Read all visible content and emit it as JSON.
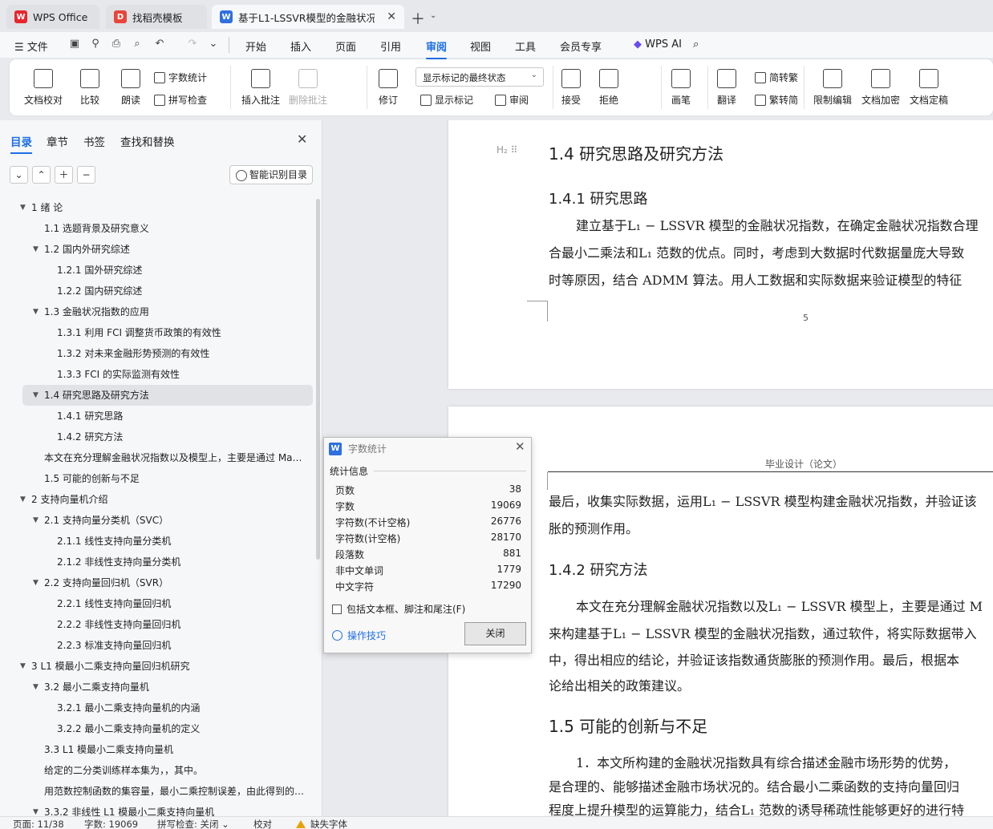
{
  "tabs": [
    {
      "label": "WPS Office",
      "icon": "wps-logo-icon"
    },
    {
      "label": "找稻壳模板",
      "icon": "docer-icon"
    },
    {
      "label": "基于L1-LSSVR模型的金融状况",
      "icon": "word-doc-icon"
    }
  ],
  "menu": {
    "file": "文件",
    "items": [
      "开始",
      "插入",
      "页面",
      "引用",
      "审阅",
      "视图",
      "工具",
      "会员专享"
    ],
    "active": "审阅",
    "ai": "WPS AI"
  },
  "ribbon": {
    "doc_proof": "文档校对",
    "compare": "比较",
    "read_aloud": "朗读",
    "word_count": "字数统计",
    "spell_check": "拼写检查",
    "insert_comment": "插入批注",
    "delete_comment": "删除批注",
    "track_changes": "修订",
    "markup_state": "显示标记的最终状态",
    "show_markup": "显示标记",
    "review_pane": "审阅",
    "accept": "接受",
    "reject": "拒绝",
    "pen": "画笔",
    "translate": "翻译",
    "to_traditional": "简转繁",
    "to_simplified": "繁转简",
    "restrict_edit": "限制编辑",
    "encrypt": "文档加密",
    "finalize": "文档定稿"
  },
  "nav": {
    "tabs": [
      "目录",
      "章节",
      "书签",
      "查找和替换"
    ],
    "smart_toc": "智能识别目录",
    "toc": [
      {
        "label": "1 绪 论",
        "level": 0,
        "arrow": true
      },
      {
        "label": "1.1 选题背景及研究意义",
        "level": 1,
        "arrow": false
      },
      {
        "label": "1.2 国内外研究综述",
        "level": 1,
        "arrow": true
      },
      {
        "label": "1.2.1 国外研究综述",
        "level": 2,
        "arrow": false
      },
      {
        "label": "1.2.2 国内研究综述",
        "level": 2,
        "arrow": false
      },
      {
        "label": "1.3 金融状况指数的应用",
        "level": 1,
        "arrow": true
      },
      {
        "label": "1.3.1 利用 FCI 调整货币政策的有效性",
        "level": 2,
        "arrow": false
      },
      {
        "label": "1.3.2 对未来金融形势预测的有效性",
        "level": 2,
        "arrow": false
      },
      {
        "label": "1.3.3 FCI 的实际监测有效性",
        "level": 2,
        "arrow": false
      },
      {
        "label": "1.4 研究思路及研究方法",
        "level": 1,
        "arrow": true,
        "selected": true
      },
      {
        "label": "1.4.1 研究思路",
        "level": 2,
        "arrow": false
      },
      {
        "label": "1.4.2 研究方法",
        "level": 2,
        "arrow": false
      },
      {
        "label": "本文在充分理解金融状况指数以及模型上，主要是通过 Mat ...",
        "level": 1,
        "arrow": false
      },
      {
        "label": "1.5 可能的创新与不足",
        "level": 1,
        "arrow": false
      },
      {
        "label": "2 支持向量机介绍",
        "level": 0,
        "arrow": true
      },
      {
        "label": "2.1 支持向量分类机（SVC）",
        "level": 1,
        "arrow": true
      },
      {
        "label": "2.1.1 线性支持向量分类机",
        "level": 2,
        "arrow": false
      },
      {
        "label": "2.1.2 非线性支持向量分类机",
        "level": 2,
        "arrow": false
      },
      {
        "label": "2.2 支持向量回归机（SVR）",
        "level": 1,
        "arrow": true
      },
      {
        "label": "2.2.1 线性支持向量回归机",
        "level": 2,
        "arrow": false
      },
      {
        "label": "2.2.2 非线性支持向量回归机",
        "level": 2,
        "arrow": false
      },
      {
        "label": "2.2.3 标准支持向量回归机",
        "level": 2,
        "arrow": false
      },
      {
        "label": "3 L1 模最小二乘支持向量回归机研究",
        "level": 0,
        "arrow": true
      },
      {
        "label": "3.2 最小二乘支持向量机",
        "level": 1,
        "arrow": true
      },
      {
        "label": "3.2.1 最小二乘支持向量机的内涵",
        "level": 2,
        "arrow": false
      },
      {
        "label": "3.2.2 最小二乘支持向量机的定义",
        "level": 2,
        "arrow": false
      },
      {
        "label": "3.3 L1 模最小二乘支持向量机",
        "level": 1,
        "arrow": false
      },
      {
        "label": "给定的二分类训练样本集为，，其中。",
        "level": 1,
        "arrow": false
      },
      {
        "label": "用范数控制函数的集容量，最小二乘控制误差，由此得到的 ...",
        "level": 1,
        "arrow": false
      },
      {
        "label": "3.3.2 非线性 L1 模最小二乘支持向量机",
        "level": 1,
        "arrow": true
      }
    ]
  },
  "doc": {
    "h2_marker": "H₂",
    "p1_h2": "1.4  研究思路及研究方法",
    "p1_h3": "1.4.1  研究思路",
    "p1_l1": "建立基于L₁ − LSSVR 模型的金融状况指数，在确定金融状况指数合理",
    "p1_l2": "合最小二乘法和L₁ 范数的优点。同时，考虑到大数据时代数据量庞大导致",
    "p1_l3": "时等原因，结合 ADMM 算法。用人工数据和实际数据来验证模型的特征",
    "page_number": "5",
    "p2_header": "毕业设计（论文）",
    "p2_l1": "最后，收集实际数据，运用L₁ − LSSVR 模型构建金融状况指数，并验证该",
    "p2_l2": "胀的预测作用。",
    "p2_h3": "1.4.2  研究方法",
    "p2_l3": "本文在充分理解金融状况指数以及L₁ − LSSVR 模型上，主要是通过 M",
    "p2_l4": "来构建基于L₁ − LSSVR 模型的金融状况指数，通过软件，将实际数据带入",
    "p2_l5": "中，得出相应的结论，并验证该指数通货膨胀的预测作用。最后，根据本",
    "p2_l6": "论给出相关的政策建议。",
    "p2_h2": "1.5  可能的创新与不足",
    "p2_l7": "1．本文所构建的金融状况指数具有综合描述金融市场形势的优势，",
    "p2_l8": "是合理的、能够描述金融市场状况的。结合最小二乘函数的支持向量回归",
    "p2_l9": "程度上提升模型的运算能力，结合L₁ 范数的诱导稀疏性能够更好的进行特"
  },
  "dialog": {
    "title": "字数统计",
    "section": "统计信息",
    "stats": [
      {
        "label": "页数",
        "value": "38"
      },
      {
        "label": "字数",
        "value": "19069"
      },
      {
        "label": "字符数(不计空格)",
        "value": "26776"
      },
      {
        "label": "字符数(计空格)",
        "value": "28170"
      },
      {
        "label": "段落数",
        "value": "881"
      },
      {
        "label": "非中文单词",
        "value": "1779"
      },
      {
        "label": "中文字符",
        "value": "17290"
      }
    ],
    "include_label": "包括文本框、脚注和尾注(F)",
    "tips": "操作技巧",
    "close": "关闭"
  },
  "status": {
    "page": "页面: 11/38",
    "words": "字数: 19069",
    "spell": "拼写检查: 关闭",
    "proof": "校对",
    "font_missing": "缺失字体"
  }
}
